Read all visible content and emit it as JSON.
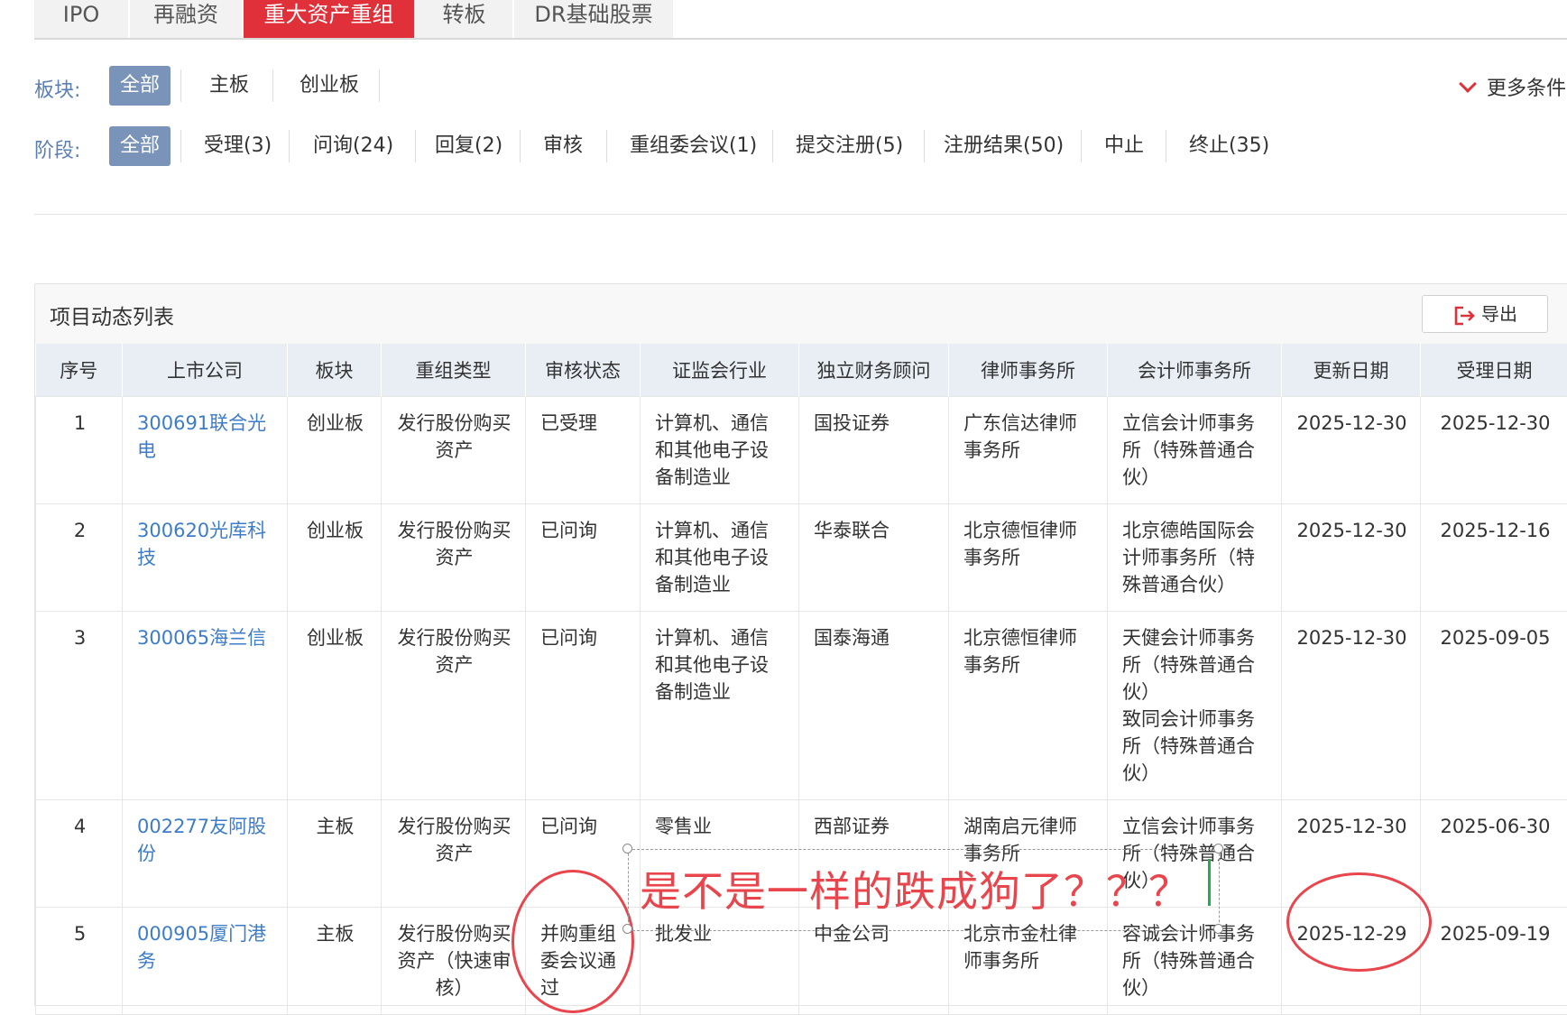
{
  "tabs": [
    "IPO",
    "再融资",
    "重大资产重组",
    "转板",
    "DR基础股票"
  ],
  "active_tab": "重大资产重组",
  "filters": {
    "board_label": "板块:",
    "board_options": [
      "全部",
      "主板",
      "创业板"
    ],
    "stage_label": "阶段:",
    "stage_options": [
      "全部",
      "受理(3)",
      "问询(24)",
      "回复(2)",
      "审核",
      "重组委会议(1)",
      "提交注册(5)",
      "注册结果(50)",
      "中止",
      "终止(35)"
    ],
    "more_label": "更多条件"
  },
  "panel": {
    "title": "项目动态列表",
    "export_label": "导出"
  },
  "table": {
    "headers": [
      "序号",
      "上市公司",
      "板块",
      "重组类型",
      "审核状态",
      "证监会行业",
      "独立财务顾问",
      "律师事务所",
      "会计师事务所",
      "更新日期",
      "受理日期"
    ],
    "rows": [
      [
        "1",
        "300691联合光电",
        "创业板",
        "发行股份购买资产",
        "已受理",
        "计算机、通信和其他电子设备制造业",
        "国投证券",
        "广东信达律师事务所",
        "立信会计师事务所（特殊普通合伙）",
        "2025-12-30",
        "2025-12-30"
      ],
      [
        "2",
        "300620光库科技",
        "创业板",
        "发行股份购买资产",
        "已问询",
        "计算机、通信和其他电子设备制造业",
        "华泰联合",
        "北京德恒律师事务所",
        "北京德皓国际会计师事务所（特殊普通合伙）",
        "2025-12-30",
        "2025-12-16"
      ],
      [
        "3",
        "300065海兰信",
        "创业板",
        "发行股份购买资产",
        "已问询",
        "计算机、通信和其他电子设备制造业",
        "国泰海通",
        "北京德恒律师事务所",
        "天健会计师事务所（特殊普通合伙）\n致同会计师事务所（特殊普通合伙）",
        "2025-12-30",
        "2025-09-05"
      ],
      [
        "4",
        "002277友阿股份",
        "主板",
        "发行股份购买资产",
        "已问询",
        "零售业",
        "西部证券",
        "湖南启元律师事务所",
        "立信会计师事务所（特殊普通合伙）",
        "2025-12-30",
        "2025-06-30"
      ],
      [
        "5",
        "000905厦门港务",
        "主板",
        "发行股份购买资产（快速审核）",
        "并购重组委会议通过",
        "批发业",
        "中金公司",
        "北京市金杜律师事务所",
        "容诚会计师事务所（特殊普通合伙）",
        "2025-12-29",
        "2025-09-19"
      ]
    ]
  },
  "annotation": {
    "text": "是不是一样的跌成狗了？？？",
    "color": "#e8454d"
  },
  "colors": {
    "accent_red": "#e0313a",
    "chip_active": "#7a93b9",
    "link_blue": "#3d7cc9",
    "label_blue": "#5b7fb3"
  }
}
